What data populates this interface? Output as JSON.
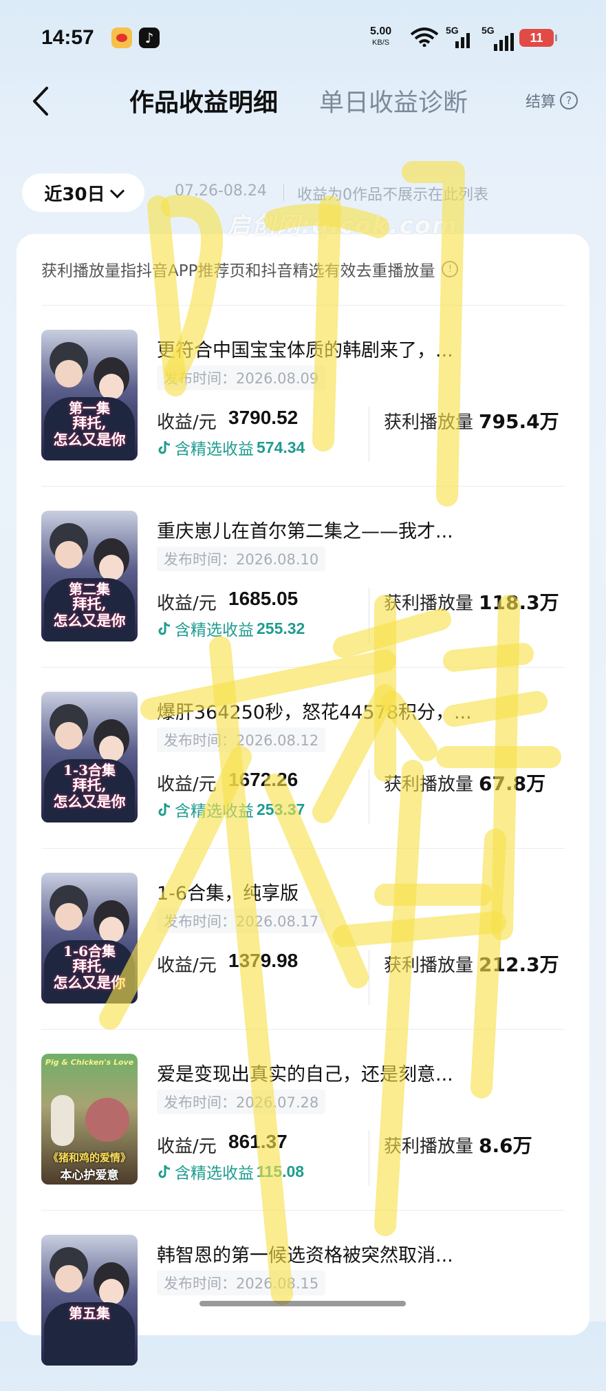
{
  "status_bar": {
    "time": "14:57",
    "net_speed": "5.00",
    "net_unit": "KB/S",
    "signal1": "5G",
    "signal2": "5G",
    "battery": "11",
    "icons": [
      "weibo-icon",
      "tiktok-icon",
      "wifi-icon",
      "signal-icon",
      "battery-icon"
    ]
  },
  "header": {
    "tab_active": "作品收益明细",
    "tab_inactive": "单日收益诊断",
    "settle_label": "结算",
    "settle_icon": "?"
  },
  "filter": {
    "range_label": "近30日",
    "date_range": "07.26-08.24",
    "note": "收益为0作品不展示在此列表"
  },
  "watermark": "启创网:qicok.com",
  "info_line": "获利播放量指抖音APP推荐页和抖音精选有效去重播放量",
  "revenue_label": "收益/元",
  "selected_label": "含精选收益",
  "plays_label": "获利播放量",
  "items": [
    {
      "title": "更符合中国宝宝体质的韩剧来了，...",
      "date": "发布时间：2026.08.09",
      "revenue": "3790.52",
      "selected": "574.34",
      "plays": "795.4万",
      "poster_ep": "第一集",
      "poster_title": "拜托,\n怎么又是你"
    },
    {
      "title": "重庆崽儿在首尔第二集之——我才...",
      "date": "发布时间：2026.08.10",
      "revenue": "1685.05",
      "selected": "255.32",
      "plays": "118.3万",
      "poster_ep": "第二集",
      "poster_title": "拜托,\n怎么又是你"
    },
    {
      "title": "爆肝364250秒，怒花44578积分，...",
      "date": "发布时间：2026.08.12",
      "revenue": "1672.26",
      "selected": "253.37",
      "plays": "67.8万",
      "poster_ep": "1-3合集",
      "poster_title": "拜托,\n怎么又是你"
    },
    {
      "title": "1-6合集，纯享版",
      "date": "发布时间：2026.08.17",
      "revenue": "1379.98",
      "selected": "",
      "plays": "212.3万",
      "poster_ep": "1-6合集",
      "poster_title": "拜托,\n怎么又是你"
    },
    {
      "title": "爱是变现出真实的自己，还是刻意...",
      "date": "发布时间：2026.07.28",
      "revenue": "861.37",
      "selected": "115.08",
      "plays": "8.6万",
      "poster_top": "Pig & Chicken's Love",
      "poster_ep": "《猪和鸡的爱情》",
      "poster_title": "本心护爱意"
    },
    {
      "title": "韩智恩的第一候选资格被突然取消...",
      "date": "发布时间：2026.08.15",
      "revenue": "",
      "selected": "",
      "plays": "",
      "poster_ep": "第五集",
      "poster_title": ""
    }
  ],
  "colors": {
    "accent_teal": "#1f9c8f",
    "handwriting": "#f7e04a"
  }
}
